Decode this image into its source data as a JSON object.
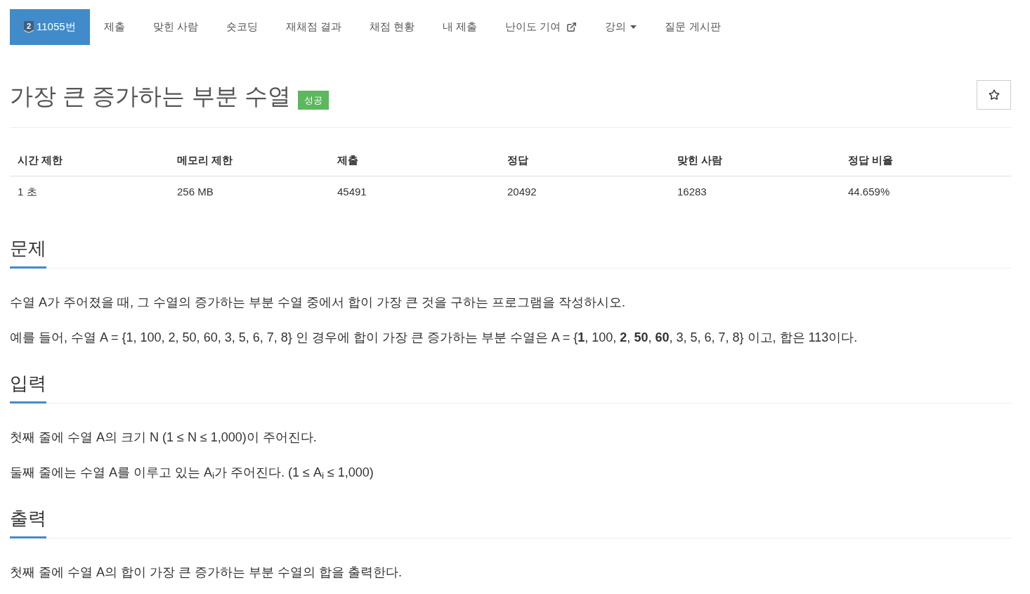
{
  "nav": [
    {
      "kind": "problem",
      "label": "11055번",
      "tier": "2",
      "selected": true
    },
    {
      "kind": "link",
      "label": "제출",
      "selected": false
    },
    {
      "kind": "link",
      "label": "맞힌 사람",
      "selected": false
    },
    {
      "kind": "link",
      "label": "숏코딩",
      "selected": false
    },
    {
      "kind": "link",
      "label": "재채점 결과",
      "selected": false
    },
    {
      "kind": "link",
      "label": "채점 현황",
      "selected": false
    },
    {
      "kind": "link",
      "label": "내 제출",
      "selected": false
    },
    {
      "kind": "external",
      "label": "난이도 기여",
      "selected": false
    },
    {
      "kind": "dropdown",
      "label": "강의",
      "selected": false
    },
    {
      "kind": "link",
      "label": "질문 게시판",
      "selected": false
    }
  ],
  "problem": {
    "title": "가장 큰 증가하는 부분 수열",
    "result_badge": "성공",
    "starred": false
  },
  "stats": {
    "columns": [
      "시간 제한",
      "메모리 제한",
      "제출",
      "정답",
      "맞힌 사람",
      "정답 비율"
    ],
    "rows": [
      [
        "1 초",
        "256 MB",
        "45491",
        "20492",
        "16283",
        "44.659%"
      ]
    ]
  },
  "sections": [
    {
      "heading": "문제",
      "paragraphs": [
        "수열 A가 주어졌을 때, 그 수열의 증가하는 부분 수열 중에서 합이 가장 큰 것을 구하는 프로그램을 작성하시오.",
        "예를 들어, 수열 A = {1, 100, 2, 50, 60, 3, 5, 6, 7, 8} 인 경우에 합이 가장 큰 증가하는 부분 수열은 A = {**1**, 100, **2**, **50**, **60**, 3, 5, 6, 7, 8} 이고, 합은 113이다."
      ]
    },
    {
      "heading": "입력",
      "paragraphs": [
        "첫째 줄에 수열 A의 크기 N (1 ≤ N ≤ 1,000)이 주어진다.",
        "둘째 줄에는 수열 A를 이루고 있는 A$_{i}$가 주어진다. (1 ≤ A$_{i}$ ≤ 1,000)"
      ]
    },
    {
      "heading": "출력",
      "paragraphs": [
        "첫째 줄에 수열 A의 합이 가장 큰 증가하는 부분 수열의 합을 출력한다."
      ]
    }
  ]
}
